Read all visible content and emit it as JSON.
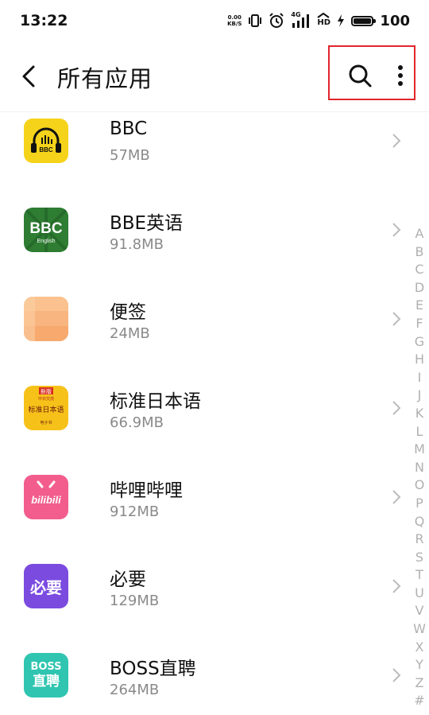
{
  "status_bar": {
    "time": "13:22",
    "speed_value": "0.00",
    "speed_unit": "KB/S",
    "network": "4G",
    "hd": "HD",
    "battery": "100"
  },
  "header": {
    "title": "所有应用",
    "back_icon": "back-arrow-icon",
    "search_icon": "search-icon",
    "more_icon": "more-vertical-icon",
    "highlight_color": "#e0262d"
  },
  "apps": [
    {
      "name": "BBC",
      "size": "57MB",
      "icon_text": "BBC",
      "icon_color": "#f5d31a"
    },
    {
      "name": "BBE英语",
      "size": "91.8MB",
      "icon_text": "BBC",
      "icon_subtext": "English",
      "icon_color": "#2e7d32"
    },
    {
      "name": "便签",
      "size": "24MB",
      "icon_color": "#f8b27a"
    },
    {
      "name": "标准日本语",
      "size": "66.9MB",
      "icon_badge": "新版",
      "icon_text": "标准日本语",
      "icon_top": "中日交流",
      "icon_bottom": "电子书",
      "icon_color": "#f6c21a"
    },
    {
      "name": "哔哩哔哩",
      "size": "912MB",
      "icon_text": "bilibili",
      "icon_color": "#f25d8e"
    },
    {
      "name": "必要",
      "size": "129MB",
      "icon_text": "必要",
      "icon_color": "#7b4be0"
    },
    {
      "name": "BOSS直聘",
      "size": "264MB",
      "icon_text": "BOSS",
      "icon_subtext": "直聘",
      "icon_color": "#2fc5b0"
    }
  ],
  "index_letters": [
    "A",
    "B",
    "C",
    "D",
    "E",
    "F",
    "G",
    "H",
    "I",
    "J",
    "K",
    "L",
    "M",
    "N",
    "O",
    "P",
    "Q",
    "R",
    "S",
    "T",
    "U",
    "V",
    "W",
    "X",
    "Y",
    "Z",
    "#"
  ]
}
